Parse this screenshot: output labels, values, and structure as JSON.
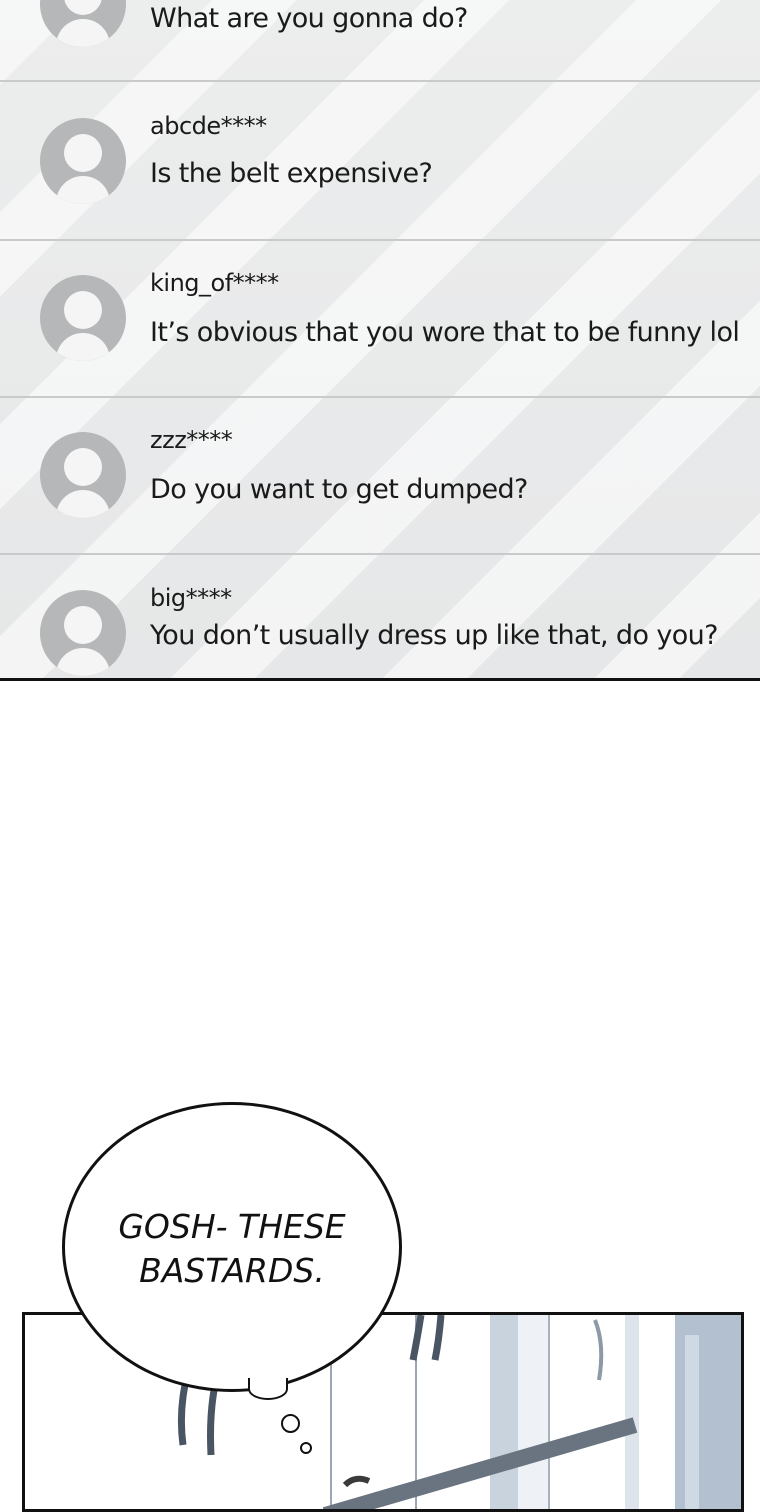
{
  "comments": [
    {
      "user": "",
      "text": "What are you gonna do?",
      "avatar_icon": "user-avatar-icon"
    },
    {
      "user": "abcde****",
      "text": "Is the belt expensive?",
      "avatar_icon": "user-avatar-icon"
    },
    {
      "user": "king_of****",
      "text": "It’s obvious that you wore that to be funny lol",
      "avatar_icon": "user-avatar-icon"
    },
    {
      "user": "zzz****",
      "text": "Do you want to get dumped?",
      "avatar_icon": "user-avatar-icon"
    },
    {
      "user": "big****",
      "text": "You don’t usually dress up like that, do you?",
      "avatar_icon": "user-avatar-icon"
    }
  ],
  "speech_bubble": {
    "line1": "GOSH- THESE",
    "line2": "BASTARDS."
  },
  "colors": {
    "panel_bg": "#e8e9ea",
    "divider": "#c9cacb",
    "avatar": "#b6b7b8",
    "text": "#1a1a1a"
  }
}
